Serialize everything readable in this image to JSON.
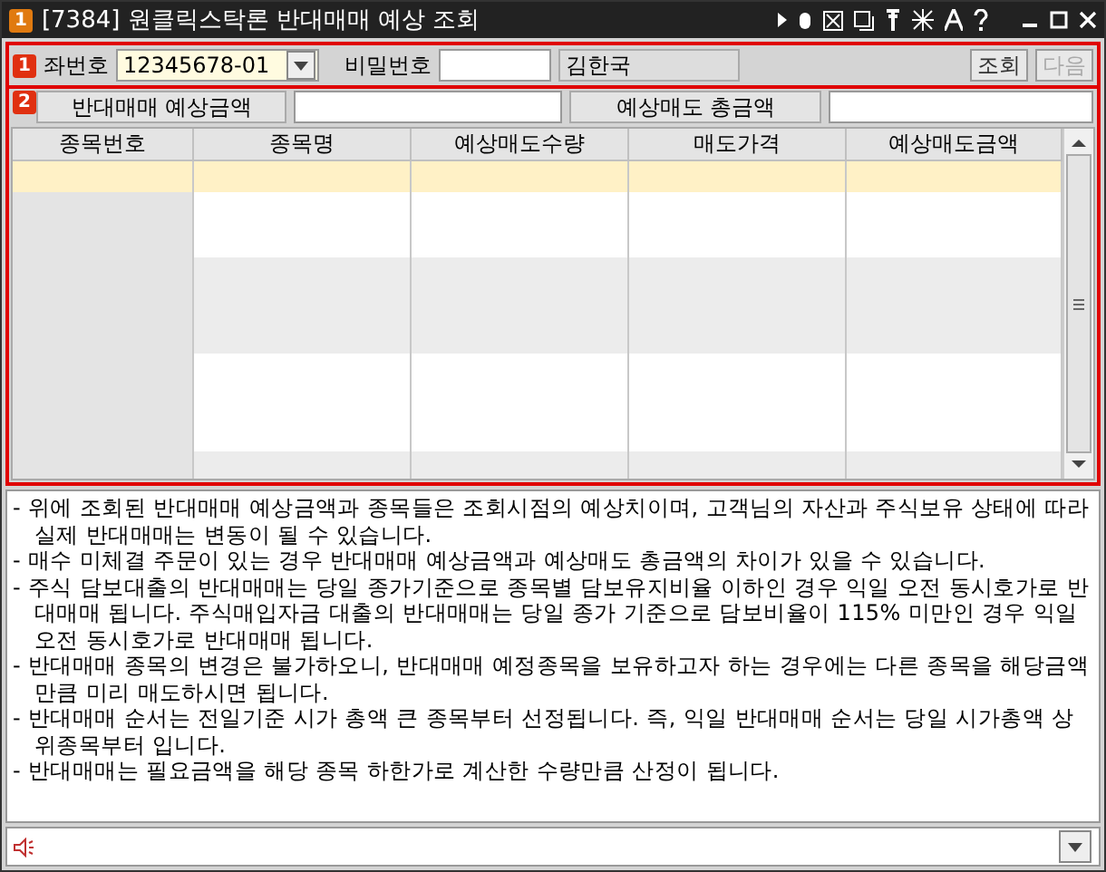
{
  "window": {
    "badge": "1",
    "title": "[7384] 원클릭스탁론 반대매매 예상 조회"
  },
  "query_bar": {
    "badge": "1",
    "account_label": "좌번호",
    "account_value": "12345678-01",
    "password_label": "비밀번호",
    "customer_name": "김한국",
    "buttons": [
      {
        "label": "조회",
        "disabled": false
      },
      {
        "label": "다음",
        "disabled": true
      }
    ]
  },
  "summary": {
    "badge": "2",
    "expected_amount_label": "반대매매 예상금액",
    "expected_sell_total_label": "예상매도 총금액"
  },
  "table": {
    "columns": [
      "종목번호",
      "종목명",
      "예상매도수량",
      "매도가격",
      "예상매도금액"
    ],
    "rows": [
      {
        "selected": true
      },
      {
        "selected": false
      },
      {
        "selected": false
      },
      {
        "selected": false
      },
      {
        "selected": false
      }
    ]
  },
  "notes": [
    "- 위에 조회된 반대매매 예상금액과 종목들은 조회시점의 예상치이며, 고객님의 자산과 주식보유 상태에 따라 실제 반대매매는 변동이 될 수 있습니다.",
    "- 매수 미체결 주문이 있는 경우 반대매매 예상금액과 예상매도 총금액의 차이가 있을 수 있습니다.",
    "- 주식 담보대출의 반대매매는 당일 종가기준으로 종목별 담보유지비율 이하인 경우 익일 오전 동시호가로 반대매매 됩니다. 주식매입자금 대출의 반대매매는 당일 종가 기준으로 담보비율이 115% 미만인 경우 익일 오전 동시호가로 반대매매 됩니다.",
    "- 반대매매 종목의 변경은 불가하오니, 반대매매 예정종목을 보유하고자 하는 경우에는 다른 종목을 해당금액 만큼 미리 매도하시면 됩니다.",
    "- 반대매매 순서는 전일기준 시가 총액 큰 종목부터 선정됩니다. 즉, 익일 반대매매 순서는 당일 시가총액 상위종목부터 입니다.",
    "- 반대매매는 필요금액을 해당 종목 하한가로 계산한 수량만큼 산정이 됩니다."
  ]
}
